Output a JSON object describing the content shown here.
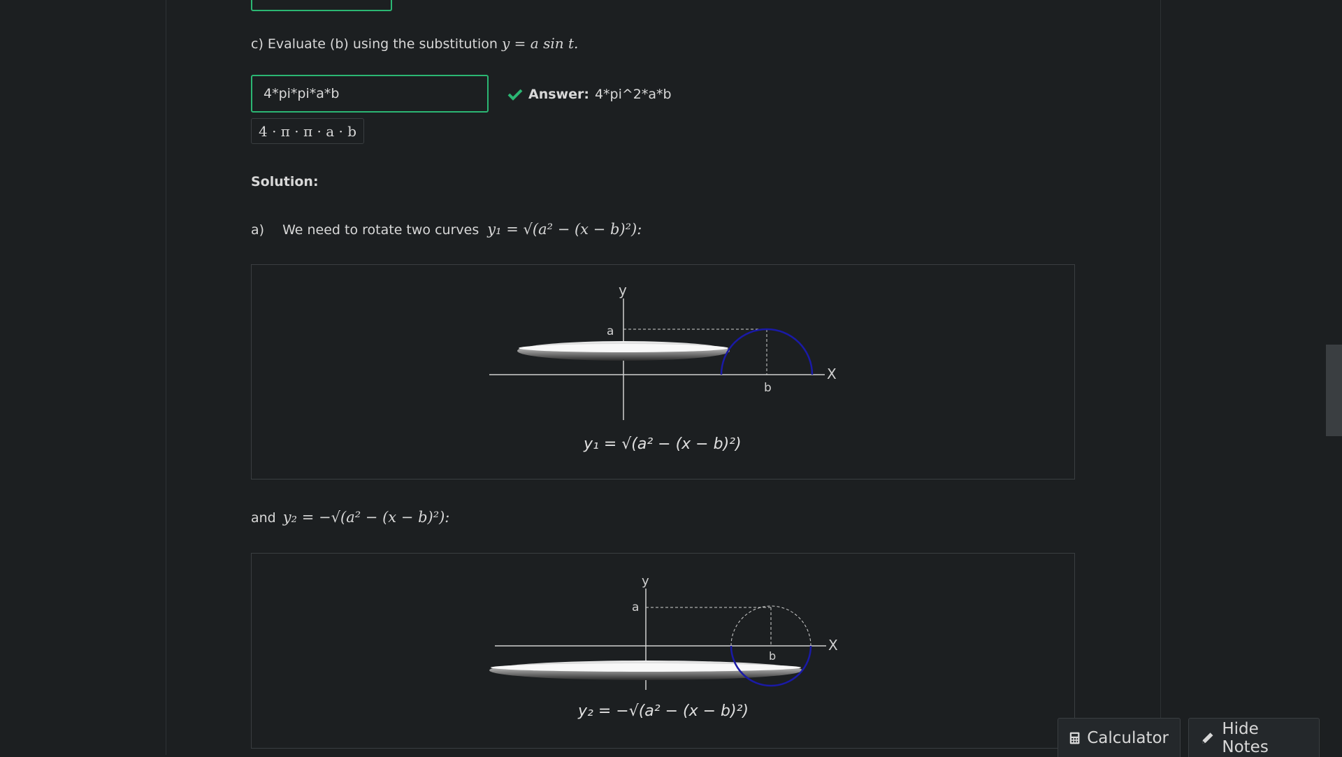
{
  "part_c": {
    "label": "c) Evaluate (b) using the substitution",
    "math": "y = a sin t."
  },
  "input": {
    "value": "4*pi*pi*a*b"
  },
  "preview": "4 · π · π · a · b",
  "feedback": {
    "label": "Answer:",
    "value": "4*pi^2*a*b"
  },
  "solution": {
    "heading": "Solution:",
    "a_label": "a)",
    "a_text": "We need to rotate two curves",
    "curve1": "y₁ = √(a² − (x − b)²):",
    "and_text": "and",
    "curve2": "y₂ = −√(a² − (x − b)²):"
  },
  "figure1": {
    "y_axis": "y",
    "x_axis": "X",
    "a_tick": "a",
    "b_tick": "b",
    "caption": "y₁ = √(a² − (x − b)²)"
  },
  "figure2": {
    "y_axis": "y",
    "x_axis": "X",
    "a_tick": "a",
    "b_tick": "b",
    "caption": "y₂ = −√(a² − (x − b)²)"
  },
  "buttons": {
    "calculator": "Calculator",
    "hide_notes": "Hide Notes"
  },
  "colors": {
    "correct": "#2bb673",
    "curve": "#1a1aa6"
  }
}
